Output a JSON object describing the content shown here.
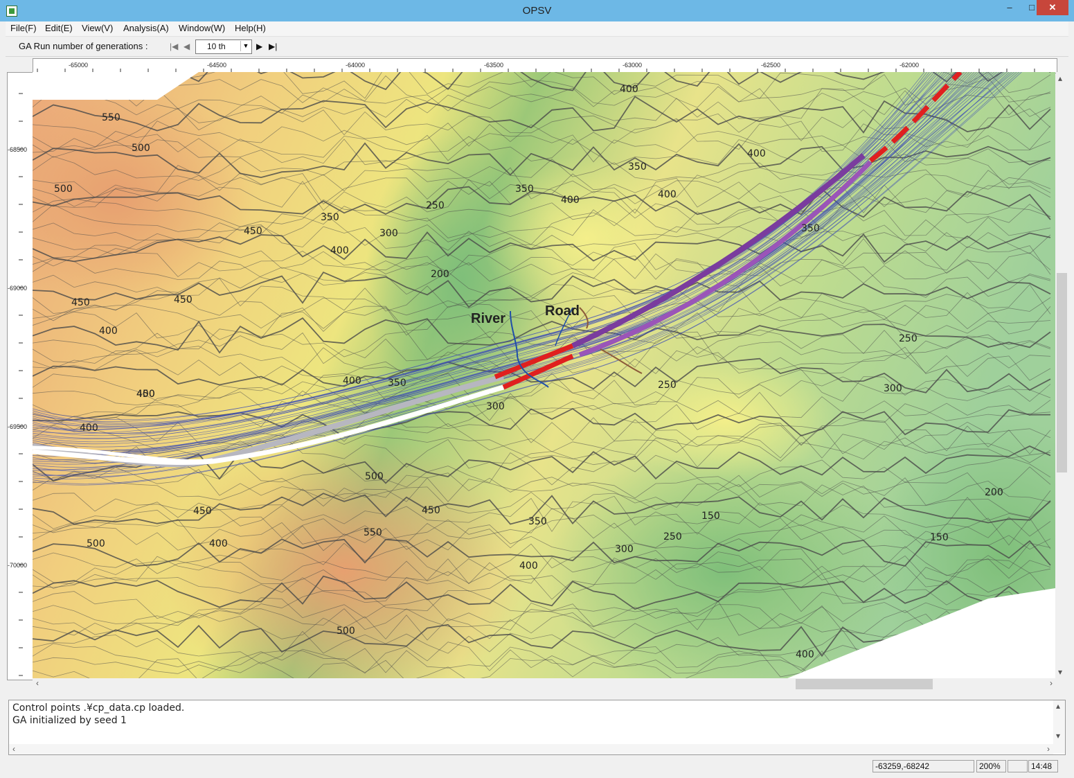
{
  "window": {
    "title": "OPSV",
    "minimize": "–",
    "maximize": "□",
    "close": "✕"
  },
  "menu": [
    {
      "label": "File(F)"
    },
    {
      "label": "Edit(E)"
    },
    {
      "label": "View(V)"
    },
    {
      "label": "Analysis(A)"
    },
    {
      "label": "Window(W)"
    },
    {
      "label": "Help(H)"
    }
  ],
  "toolbar": {
    "generations_label": "GA Run number of generations :",
    "generation_value": "10 th",
    "first_icon": "skip-first-icon",
    "prev_icon": "prev-icon",
    "next_icon": "next-icon",
    "last_icon": "skip-last-icon"
  },
  "ruler": {
    "x_labels": [
      "-65000",
      "-64500",
      "-64000",
      "-63500",
      "-63000",
      "-62500",
      "-62000"
    ],
    "y_labels": [
      "-68500",
      "-69000",
      "-69500",
      "-70000"
    ]
  },
  "map": {
    "labels": {
      "river": "River",
      "road": "Road"
    },
    "contour_labels": [
      "550",
      "500",
      "500",
      "450",
      "450",
      "450",
      "450",
      "400",
      "400",
      "350",
      "400",
      "300",
      "250",
      "200",
      "350",
      "400",
      "350",
      "400",
      "400",
      "350",
      "400",
      "400",
      "500",
      "450",
      "500",
      "400",
      "550",
      "450",
      "350",
      "500",
      "400",
      "300",
      "350",
      "400",
      "150",
      "250",
      "150",
      "200",
      "300",
      "250",
      "250",
      "300",
      "400"
    ]
  },
  "log": {
    "lines": [
      "Control points .¥cp_data.cp loaded.",
      "GA initialized by seed 1"
    ]
  },
  "status": {
    "coords": "-63259,-68242",
    "zoom": "200%",
    "time": "14:48"
  },
  "colors": {
    "titlebar": "#6db8e6",
    "close": "#c7463b",
    "route_purple": "#7a3c9e",
    "route_red": "#e0201f",
    "route_gray": "#b7b7c0",
    "candidate_lines": "#3f4fb5"
  }
}
